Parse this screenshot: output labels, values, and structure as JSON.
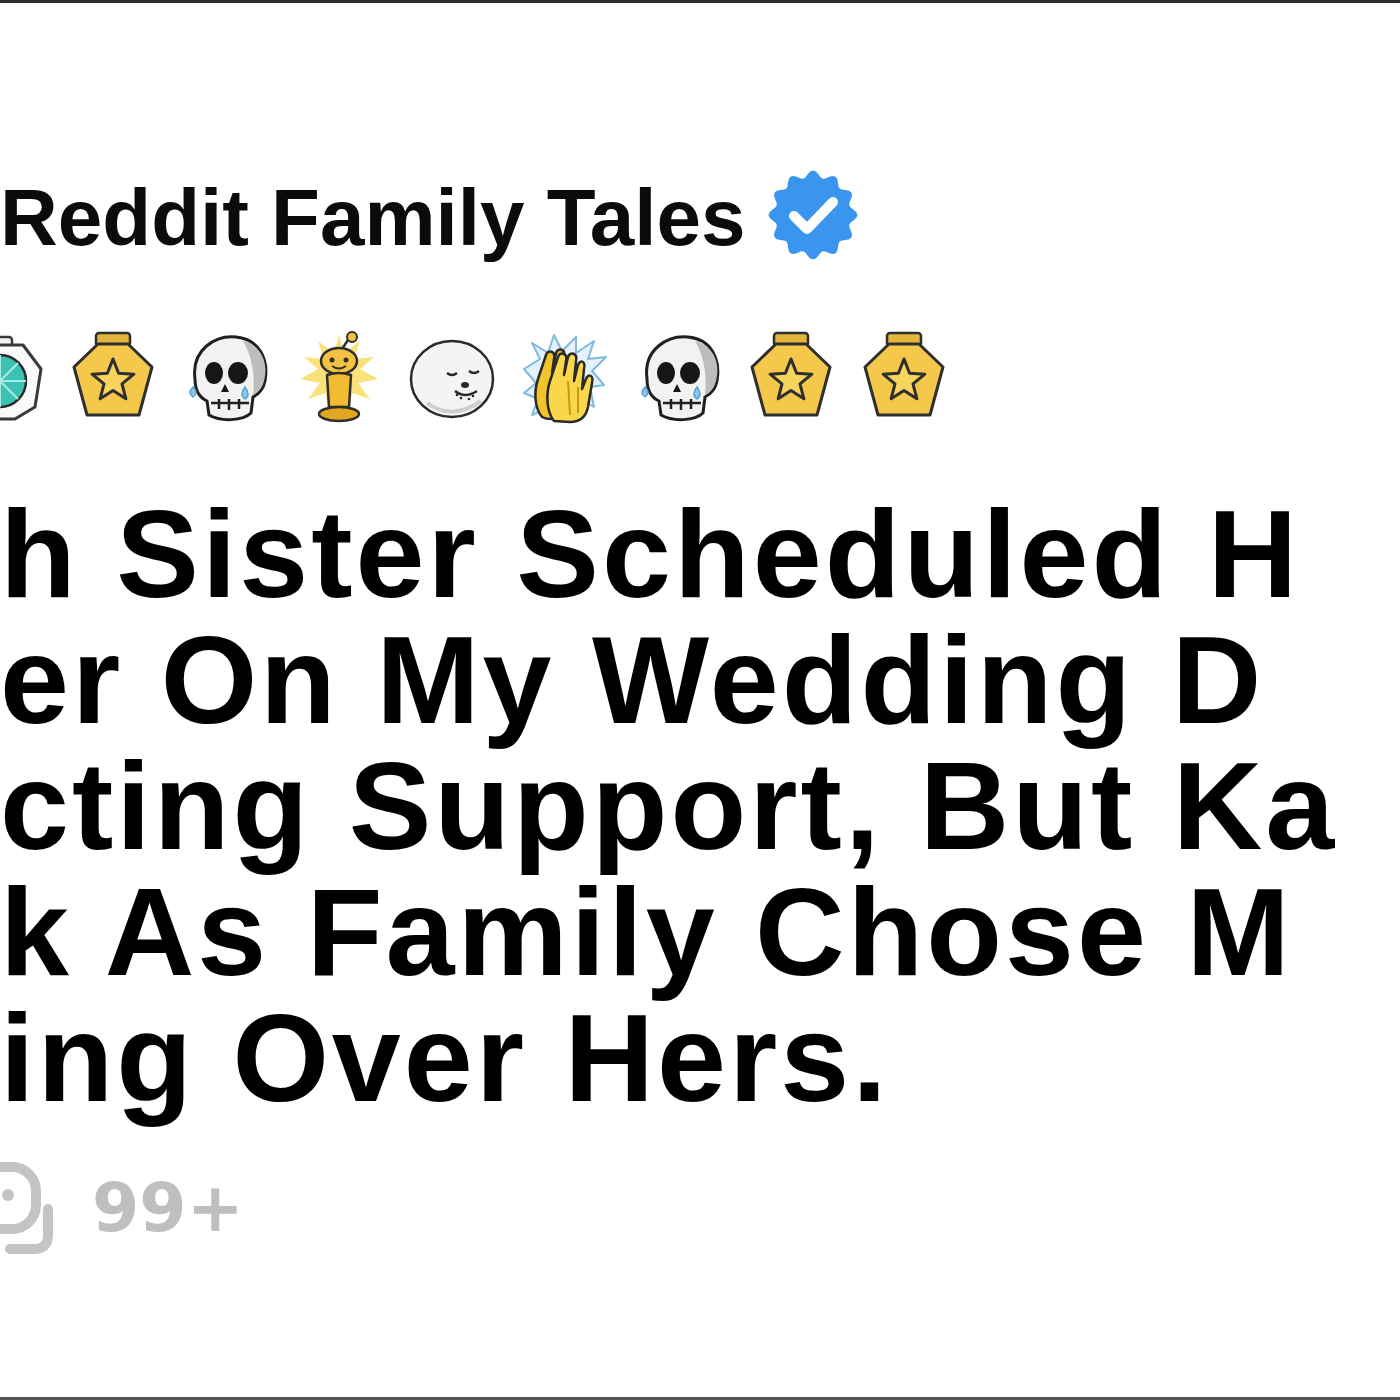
{
  "author": {
    "name": "Reddit Family Tales",
    "verified": true
  },
  "awards": [
    {
      "kind": "gem"
    },
    {
      "kind": "star_medal"
    },
    {
      "kind": "skull"
    },
    {
      "kind": "gold_figure"
    },
    {
      "kind": "seal"
    },
    {
      "kind": "clapping_hands"
    },
    {
      "kind": "skull"
    },
    {
      "kind": "star_medal"
    },
    {
      "kind": "star_medal"
    }
  ],
  "title_lines": [
    "h Sister Scheduled H",
    "er On My Wedding D",
    "cting Support, But Ka",
    "k As Family Chose M",
    "ing Over Hers."
  ],
  "comments": {
    "count": "99+"
  }
}
